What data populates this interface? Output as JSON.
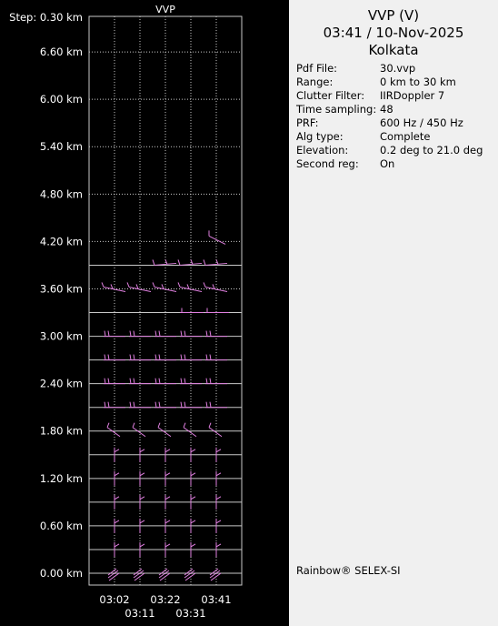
{
  "chart_data": {
    "type": "wind-barb-profile",
    "title": "VVP",
    "y_axis": {
      "tick_labels": [
        "Step: 0.30 km",
        "6.60 km",
        "6.00 km",
        "5.40 km",
        "4.80 km",
        "4.20 km",
        "3.60 km",
        "3.00 km",
        "2.40 km",
        "1.80 km",
        "1.20 km",
        "0.60 km",
        "0.00 km"
      ],
      "ylim_km": [
        -0.15,
        7.05
      ],
      "step_km": 0.3
    },
    "x_axis": {
      "tick_labels_top": [
        "03:02",
        "03:22",
        "03:41"
      ],
      "tick_labels_bottom": [
        "03:11",
        "03:31"
      ],
      "times": [
        "03:02",
        "03:11",
        "03:22",
        "03:31",
        "03:41"
      ]
    },
    "barb_color": "#e080e0",
    "grid": true,
    "series": [
      {
        "time": "03:02",
        "heights_km": [
          0.0,
          0.3,
          0.6,
          0.9,
          1.2,
          1.5,
          1.8,
          2.1,
          2.4,
          2.7,
          3.0,
          3.6
        ]
      },
      {
        "time": "03:11",
        "heights_km": [
          0.0,
          0.3,
          0.6,
          0.9,
          1.2,
          1.5,
          1.8,
          2.1,
          2.4,
          2.7,
          3.0,
          3.6
        ]
      },
      {
        "time": "03:22",
        "heights_km": [
          0.0,
          0.3,
          0.6,
          0.9,
          1.2,
          1.5,
          1.8,
          2.1,
          2.4,
          2.7,
          3.0,
          3.6,
          3.9
        ]
      },
      {
        "time": "03:31",
        "heights_km": [
          0.0,
          0.3,
          0.6,
          0.9,
          1.2,
          1.5,
          1.8,
          2.1,
          2.4,
          2.7,
          3.0,
          3.3,
          3.6,
          3.9
        ]
      },
      {
        "time": "03:41",
        "heights_km": [
          0.0,
          0.3,
          0.6,
          0.9,
          1.2,
          1.5,
          1.8,
          2.1,
          2.4,
          2.7,
          3.0,
          3.3,
          3.6,
          3.9,
          4.2
        ]
      }
    ]
  },
  "panel": {
    "title_line1": "VVP (V)",
    "title_line2": "03:41 / 10-Nov-2025",
    "title_line3": "Kolkata",
    "rows": [
      {
        "key": "Pdf File:",
        "value": "30.vvp"
      },
      {
        "key": "Range:",
        "value": "0 km to 30 km"
      },
      {
        "key": "Clutter Filter:",
        "value": "IIRDoppler 7"
      },
      {
        "key": "Time sampling:",
        "value": "48"
      },
      {
        "key": "PRF:",
        "value": "600 Hz / 450 Hz"
      },
      {
        "key": "Alg type:",
        "value": "Complete"
      },
      {
        "key": "Elevation:",
        "value": "0.2 deg to 21.0 deg"
      },
      {
        "key": "Second reg:",
        "value": "On"
      }
    ],
    "footer": "Rainbow® SELEX-SI"
  }
}
